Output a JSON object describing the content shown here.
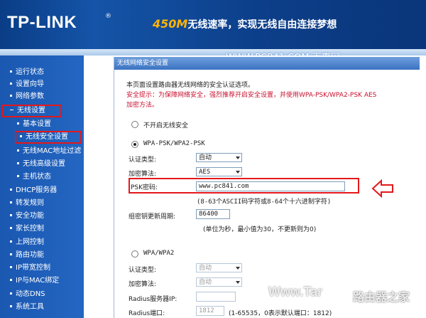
{
  "header": {
    "logo": "TP-LINK",
    "logo_mark": "®",
    "banner_speed": "450M",
    "banner_text": "无线速率，实现无线自由连接梦想",
    "watermark": "WWW.PC841.COM 百事网"
  },
  "sidebar": {
    "items": [
      {
        "label": "运行状态"
      },
      {
        "label": "设置向导"
      },
      {
        "label": "网络参数"
      },
      {
        "label": "无线设置"
      },
      {
        "label": "基本设置"
      },
      {
        "label": "无线安全设置"
      },
      {
        "label": "无线MAC地址过滤"
      },
      {
        "label": "无线高级设置"
      },
      {
        "label": "主机状态"
      },
      {
        "label": "DHCP服务器"
      },
      {
        "label": "转发规则"
      },
      {
        "label": "安全功能"
      },
      {
        "label": "家长控制"
      },
      {
        "label": "上网控制"
      },
      {
        "label": "路由功能"
      },
      {
        "label": "IP带宽控制"
      },
      {
        "label": "IP与MAC绑定"
      },
      {
        "label": "动态DNS"
      },
      {
        "label": "系统工具"
      }
    ]
  },
  "main": {
    "title": "无线网络安全设置",
    "intro": "本页面设置路由器无线网络的安全认证选项。",
    "warning_line1": "安全提示：为保障网络安全，强烈推荐开启安全设置，并使用WPA-PSK/WPA2-PSK AES",
    "warning_line2": "加密方法。",
    "option_none": "不开启无线安全",
    "option_wpa_psk": "WPA-PSK/WPA2-PSK",
    "auth_label": "认证类型:",
    "auth_value": "自动",
    "enc_label": "加密算法:",
    "enc_value": "AES",
    "psk_label": "PSK密码:",
    "psk_value": "www.pc841.com",
    "psk_hint": "(8-63个ASCII码字符或8-64个十六进制字符)",
    "rekey_label": "组密钥更新周期:",
    "rekey_value": "86400",
    "rekey_hint": "(单位为秒，最小值为30，不更新则为0)",
    "option_wpa": "WPA/WPA2",
    "wpa_auth_label": "认证类型:",
    "wpa_auth_value": "自动",
    "wpa_enc_label": "加密算法:",
    "wpa_enc_value": "自动",
    "radius_ip_label": "Radius服务器IP:",
    "radius_ip_value": "",
    "radius_port_label": "Radius端口:",
    "radius_port_value": "1812",
    "radius_port_hint": "(1-65535，0表示默认端口：1812)"
  },
  "overlay": {
    "watermark_bottom": "Www.Tar",
    "watermark_bottom_cn": "路由器之家"
  },
  "colors": {
    "highlight": "#e4171b",
    "sidebar": "#1f60bb",
    "header": "#0c3f8a",
    "banner_speed": "#ffb400"
  }
}
